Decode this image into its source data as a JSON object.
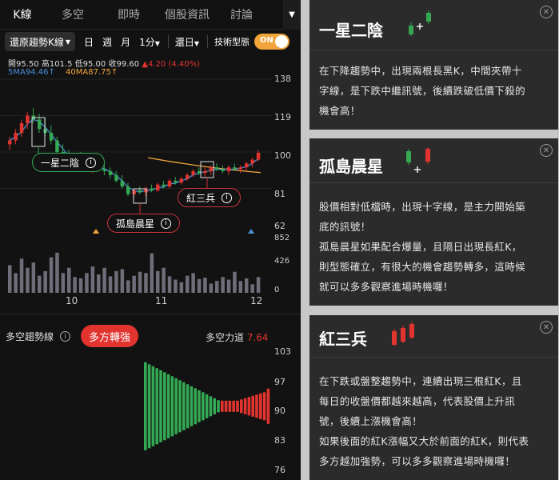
{
  "tabs": [
    "K線",
    "多空",
    "即時",
    "個股資訊",
    "討論"
  ],
  "toolbar": {
    "adjust_label": "還原趨勢K線",
    "periods": [
      "日",
      "週",
      "月",
      "1分"
    ],
    "range_label": "還日",
    "pattern_label": "技術型態",
    "toggle_label": "ON"
  },
  "quote": {
    "open": "開95.50",
    "high": "高101.5",
    "low": "低95.00",
    "close": "收99.60",
    "change": "▲4.20 (4.40%)",
    "ma5": "5MA94.46↑",
    "ma40": "40MA87.75↑"
  },
  "price_axis": [
    "138",
    "119",
    "100",
    "81",
    "62"
  ],
  "volume_axis": [
    "852",
    "426",
    "0"
  ],
  "x_axis": [
    "10",
    "11",
    "12"
  ],
  "pattern_tags": {
    "one_star": "一星二陰",
    "island": "孤島晨星",
    "three_red": "紅三兵"
  },
  "trend": {
    "title": "多空趨勢線",
    "badge": "多方轉強",
    "strength_label": "多空力道",
    "strength_value": "7.64",
    "axis": [
      "103",
      "97",
      "90",
      "83",
      "76"
    ]
  },
  "cards": [
    {
      "title": "一星二陰",
      "lines": [
        "在下降趨勢中，出現兩根長黑K，中間夾帶十",
        "字線，是下跌中繼訊號，後續跌破低價下殺的",
        "機會高！"
      ]
    },
    {
      "title": "孤島晨星",
      "lines": [
        "股價相對低檔時，出現十字線，是主力開始築",
        "底的訊號！",
        "孤島晨星如果配合爆量，且隔日出現長紅K，",
        "則型態確立，有很大的機會趨勢轉多，這時候",
        "就可以多多觀察進場時機囉！"
      ]
    },
    {
      "title": "紅三兵",
      "lines": [
        "在下跌或盤整趨勢中，連續出現三根紅K，且",
        "每日的收盤價都越來越高，代表股價上升訊",
        "號，後續上漲機會高！",
        "如果後面的紅K漲幅又大於前面的紅K，則代表",
        "多方越加強勢，可以多多觀察進場時機囉！"
      ]
    }
  ],
  "colors": {
    "up": "#e2342f",
    "down": "#34a853",
    "accent": "#f2a53a",
    "ma5": "#4a90d9"
  },
  "chart_data": {
    "type": "candlestick",
    "candles": [
      {
        "o": 104,
        "h": 108,
        "l": 101,
        "c": 106
      },
      {
        "o": 106,
        "h": 112,
        "l": 104,
        "c": 110
      },
      {
        "o": 110,
        "h": 117,
        "l": 108,
        "c": 115
      },
      {
        "o": 115,
        "h": 121,
        "l": 112,
        "c": 119
      },
      {
        "o": 119,
        "h": 123,
        "l": 115,
        "c": 117
      },
      {
        "o": 117,
        "h": 120,
        "l": 110,
        "c": 112
      },
      {
        "o": 112,
        "h": 118,
        "l": 108,
        "c": 110
      },
      {
        "o": 110,
        "h": 114,
        "l": 104,
        "c": 106
      },
      {
        "o": 106,
        "h": 108,
        "l": 98,
        "c": 100
      },
      {
        "o": 100,
        "h": 104,
        "l": 97,
        "c": 99
      },
      {
        "o": 99,
        "h": 101,
        "l": 93,
        "c": 95
      },
      {
        "o": 95,
        "h": 99,
        "l": 93,
        "c": 97
      },
      {
        "o": 97,
        "h": 100,
        "l": 94,
        "c": 95
      },
      {
        "o": 95,
        "h": 97,
        "l": 90,
        "c": 92
      },
      {
        "o": 92,
        "h": 95,
        "l": 89,
        "c": 93
      },
      {
        "o": 93,
        "h": 96,
        "l": 90,
        "c": 91
      },
      {
        "o": 91,
        "h": 94,
        "l": 88,
        "c": 90
      },
      {
        "o": 90,
        "h": 92,
        "l": 86,
        "c": 88
      },
      {
        "o": 88,
        "h": 90,
        "l": 84,
        "c": 85
      },
      {
        "o": 85,
        "h": 88,
        "l": 81,
        "c": 82
      },
      {
        "o": 82,
        "h": 84,
        "l": 77,
        "c": 78
      },
      {
        "o": 78,
        "h": 81,
        "l": 76,
        "c": 80
      },
      {
        "o": 80,
        "h": 82,
        "l": 78,
        "c": 79
      },
      {
        "o": 79,
        "h": 82,
        "l": 77,
        "c": 81
      },
      {
        "o": 81,
        "h": 83,
        "l": 79,
        "c": 80
      },
      {
        "o": 80,
        "h": 84,
        "l": 79,
        "c": 83
      },
      {
        "o": 83,
        "h": 85,
        "l": 81,
        "c": 82
      },
      {
        "o": 82,
        "h": 86,
        "l": 81,
        "c": 85
      },
      {
        "o": 85,
        "h": 87,
        "l": 83,
        "c": 84
      },
      {
        "o": 84,
        "h": 87,
        "l": 83,
        "c": 86
      },
      {
        "o": 86,
        "h": 89,
        "l": 85,
        "c": 88
      },
      {
        "o": 88,
        "h": 91,
        "l": 87,
        "c": 90
      },
      {
        "o": 90,
        "h": 92,
        "l": 88,
        "c": 89
      },
      {
        "o": 89,
        "h": 92,
        "l": 87,
        "c": 90
      },
      {
        "o": 90,
        "h": 93,
        "l": 88,
        "c": 92
      },
      {
        "o": 92,
        "h": 94,
        "l": 90,
        "c": 91
      },
      {
        "o": 91,
        "h": 93,
        "l": 89,
        "c": 90
      },
      {
        "o": 90,
        "h": 93,
        "l": 88,
        "c": 92
      },
      {
        "o": 92,
        "h": 94,
        "l": 90,
        "c": 91
      },
      {
        "o": 91,
        "h": 93,
        "l": 89,
        "c": 92
      },
      {
        "o": 92,
        "h": 95,
        "l": 90,
        "c": 94
      },
      {
        "o": 94,
        "h": 97,
        "l": 92,
        "c": 96
      },
      {
        "o": 96,
        "h": 101,
        "l": 95,
        "c": 99.6
      }
    ],
    "volume": [
      420,
      300,
      520,
      380,
      460,
      260,
      330,
      540,
      610,
      300,
      380,
      240,
      220,
      300,
      400,
      280,
      380,
      250,
      330,
      360,
      190,
      260,
      320,
      300,
      600,
      330,
      380,
      250,
      200,
      160,
      260,
      300,
      210,
      230,
      140,
      180,
      240,
      200,
      320,
      180,
      220,
      130,
      240
    ],
    "trend_values": [
      100,
      99,
      98,
      97,
      96,
      95,
      94,
      93,
      92,
      91,
      90,
      89.5,
      89,
      88.6,
      88.3,
      88.1,
      88.2,
      88.6,
      89,
      89.3,
      89.5,
      89.6,
      89.5,
      89.2,
      88.8,
      88.5,
      88.4,
      88.6,
      89,
      89.4,
      89.8,
      90.2,
      95
    ]
  }
}
